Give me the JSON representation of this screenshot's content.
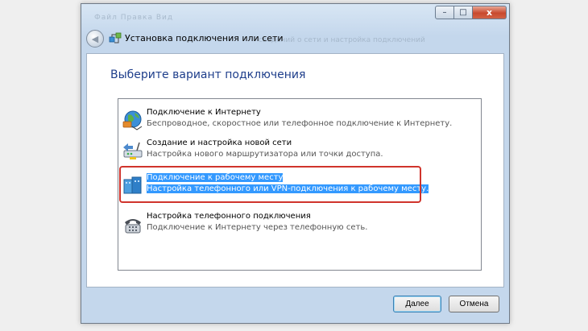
{
  "window": {
    "title": "Установка подключения или сети",
    "ghost_menu": "Файл  Правка  Вид",
    "ghost_text": "сведений о сети и настройка подключений",
    "caption": {
      "minimize": "–",
      "maximize": "□",
      "close": "x"
    }
  },
  "heading": "Выберите вариант подключения",
  "options": [
    {
      "title": "Подключение к Интернету",
      "description": "Беспроводное, скоростное или телефонное подключение к Интернету.",
      "icon": "globe-internet-icon"
    },
    {
      "title": "Создание и настройка новой сети",
      "description": "Настройка нового маршрутизатора или точки доступа.",
      "icon": "router-setup-icon"
    },
    {
      "title": "Подключение к рабочему месту",
      "description": "Настройка телефонного или VPN-подключения к рабочему месту.",
      "icon": "workplace-vpn-icon",
      "selected": true
    },
    {
      "title": "Настройка телефонного подключения",
      "description": "Подключение к Интернету через телефонную сеть.",
      "icon": "dialup-phone-icon"
    }
  ],
  "buttons": {
    "next": "Далее",
    "cancel": "Отмена"
  },
  "colors": {
    "heading": "#1e3e8b",
    "selection": "#3399ff",
    "annotation": "#d0342c"
  }
}
